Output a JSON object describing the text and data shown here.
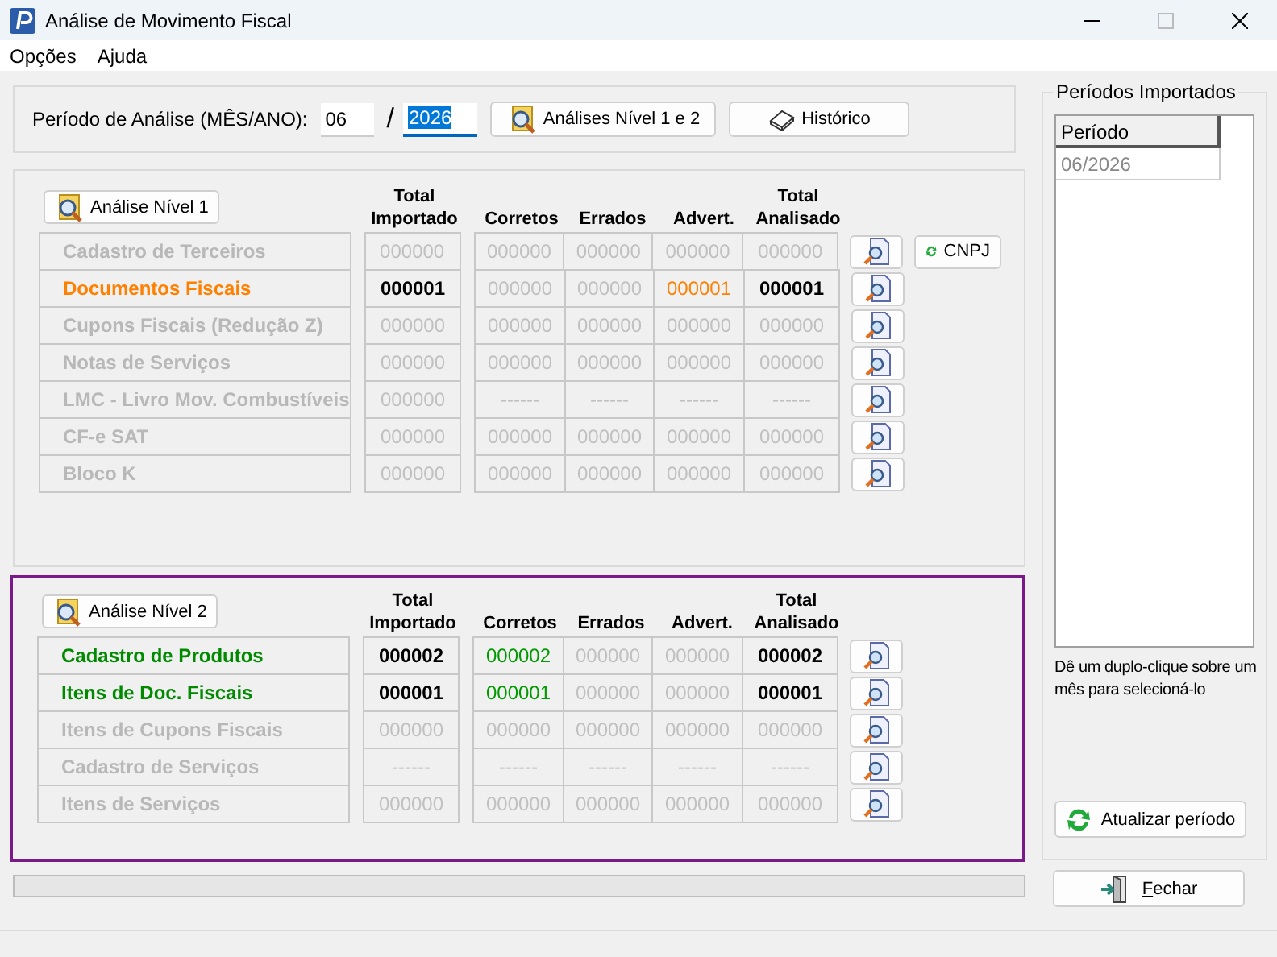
{
  "window": {
    "title": "Análise de Movimento Fiscal"
  },
  "menu": [
    "Opções",
    "Ajuda"
  ],
  "period": {
    "label": "Período de Análise (MÊS/ANO):",
    "month": "06",
    "separator": "/",
    "year": "2026",
    "year_highlighted": true,
    "buttons": [
      "Análises Nível 1 e 2",
      "Histórico"
    ]
  },
  "levels": [
    {
      "button": "Análise Nível 1",
      "frame_highlighted": false,
      "headers": [
        "Total Importado",
        "Corretos",
        "Errados",
        "Advert.",
        "Total Analisado"
      ],
      "rows": [
        {
          "label": "Cadastro de Terceiros",
          "kind": "inactive",
          "extra_button": "CNPJ",
          "cells": [
            {
              "text": "000000",
              "kind": "inactive"
            },
            {
              "text": "000000",
              "kind": "inactive"
            },
            {
              "text": "000000",
              "kind": "inactive"
            },
            {
              "text": "000000",
              "kind": "inactive"
            },
            {
              "text": "000000",
              "kind": "inactive"
            }
          ]
        },
        {
          "label": "Documentos Fiscais",
          "kind": "warning",
          "cells": [
            {
              "text": "000001",
              "kind": "active"
            },
            {
              "text": "000000",
              "kind": "inactive"
            },
            {
              "text": "000000",
              "kind": "inactive"
            },
            {
              "text": "000001",
              "kind": "warning"
            },
            {
              "text": "000001",
              "kind": "active"
            }
          ]
        },
        {
          "label": "Cupons Fiscais (Redução Z)",
          "kind": "inactive",
          "cells": [
            {
              "text": "000000",
              "kind": "inactive"
            },
            {
              "text": "000000",
              "kind": "inactive"
            },
            {
              "text": "000000",
              "kind": "inactive"
            },
            {
              "text": "000000",
              "kind": "inactive"
            },
            {
              "text": "000000",
              "kind": "inactive"
            }
          ]
        },
        {
          "label": "Notas de Serviços",
          "kind": "inactive",
          "cells": [
            {
              "text": "000000",
              "kind": "inactive"
            },
            {
              "text": "000000",
              "kind": "inactive"
            },
            {
              "text": "000000",
              "kind": "inactive"
            },
            {
              "text": "000000",
              "kind": "inactive"
            },
            {
              "text": "000000",
              "kind": "inactive"
            }
          ]
        },
        {
          "label": "LMC - Livro Mov. Combustíveis",
          "kind": "inactive",
          "cells": [
            {
              "text": "000000",
              "kind": "inactive"
            },
            {
              "text": "------",
              "kind": "inactive"
            },
            {
              "text": "------",
              "kind": "inactive"
            },
            {
              "text": "------",
              "kind": "inactive"
            },
            {
              "text": "------",
              "kind": "inactive"
            }
          ]
        },
        {
          "label": "CF-e SAT",
          "kind": "inactive",
          "cells": [
            {
              "text": "000000",
              "kind": "inactive"
            },
            {
              "text": "000000",
              "kind": "inactive"
            },
            {
              "text": "000000",
              "kind": "inactive"
            },
            {
              "text": "000000",
              "kind": "inactive"
            },
            {
              "text": "000000",
              "kind": "inactive"
            }
          ]
        },
        {
          "label": "Bloco K",
          "kind": "inactive",
          "cells": [
            {
              "text": "000000",
              "kind": "inactive"
            },
            {
              "text": "000000",
              "kind": "inactive"
            },
            {
              "text": "000000",
              "kind": "inactive"
            },
            {
              "text": "000000",
              "kind": "inactive"
            },
            {
              "text": "000000",
              "kind": "inactive"
            }
          ]
        }
      ]
    },
    {
      "button": "Análise Nível 2",
      "frame_highlighted": true,
      "headers": [
        "Total Importado",
        "Corretos",
        "Errados",
        "Advert.",
        "Total Analisado"
      ],
      "rows": [
        {
          "label": "Cadastro de Produtos",
          "kind": "ok",
          "cells": [
            {
              "text": "000002",
              "kind": "active"
            },
            {
              "text": "000002",
              "kind": "ok"
            },
            {
              "text": "000000",
              "kind": "inactive"
            },
            {
              "text": "000000",
              "kind": "inactive"
            },
            {
              "text": "000002",
              "kind": "active"
            }
          ]
        },
        {
          "label": "Itens de Doc. Fiscais",
          "kind": "ok",
          "cells": [
            {
              "text": "000001",
              "kind": "active"
            },
            {
              "text": "000001",
              "kind": "ok"
            },
            {
              "text": "000000",
              "kind": "inactive"
            },
            {
              "text": "000000",
              "kind": "inactive"
            },
            {
              "text": "000001",
              "kind": "active"
            }
          ]
        },
        {
          "label": "Itens de Cupons Fiscais",
          "kind": "inactive",
          "cells": [
            {
              "text": "000000",
              "kind": "inactive"
            },
            {
              "text": "000000",
              "kind": "inactive"
            },
            {
              "text": "000000",
              "kind": "inactive"
            },
            {
              "text": "000000",
              "kind": "inactive"
            },
            {
              "text": "000000",
              "kind": "inactive"
            }
          ]
        },
        {
          "label": "Cadastro de Serviços",
          "kind": "inactive",
          "cells": [
            {
              "text": "------",
              "kind": "inactive"
            },
            {
              "text": "------",
              "kind": "inactive"
            },
            {
              "text": "------",
              "kind": "inactive"
            },
            {
              "text": "------",
              "kind": "inactive"
            },
            {
              "text": "------",
              "kind": "inactive"
            }
          ]
        },
        {
          "label": "Itens de Serviços",
          "kind": "inactive",
          "cells": [
            {
              "text": "000000",
              "kind": "inactive"
            },
            {
              "text": "000000",
              "kind": "inactive"
            },
            {
              "text": "000000",
              "kind": "inactive"
            },
            {
              "text": "000000",
              "kind": "inactive"
            },
            {
              "text": "000000",
              "kind": "inactive"
            }
          ]
        }
      ]
    }
  ],
  "progress": {
    "level": 0
  },
  "periods": {
    "title": "Períodos Importados",
    "column": "Período",
    "rows": [
      {
        "text": "06/2026",
        "selected": false
      }
    ],
    "hint": "Dê um duplo-clique sobre um mês para selecioná-lo",
    "refresh_button": "Atualizar período"
  },
  "close_button": {
    "label": "Fechar",
    "underline_first": true
  }
}
